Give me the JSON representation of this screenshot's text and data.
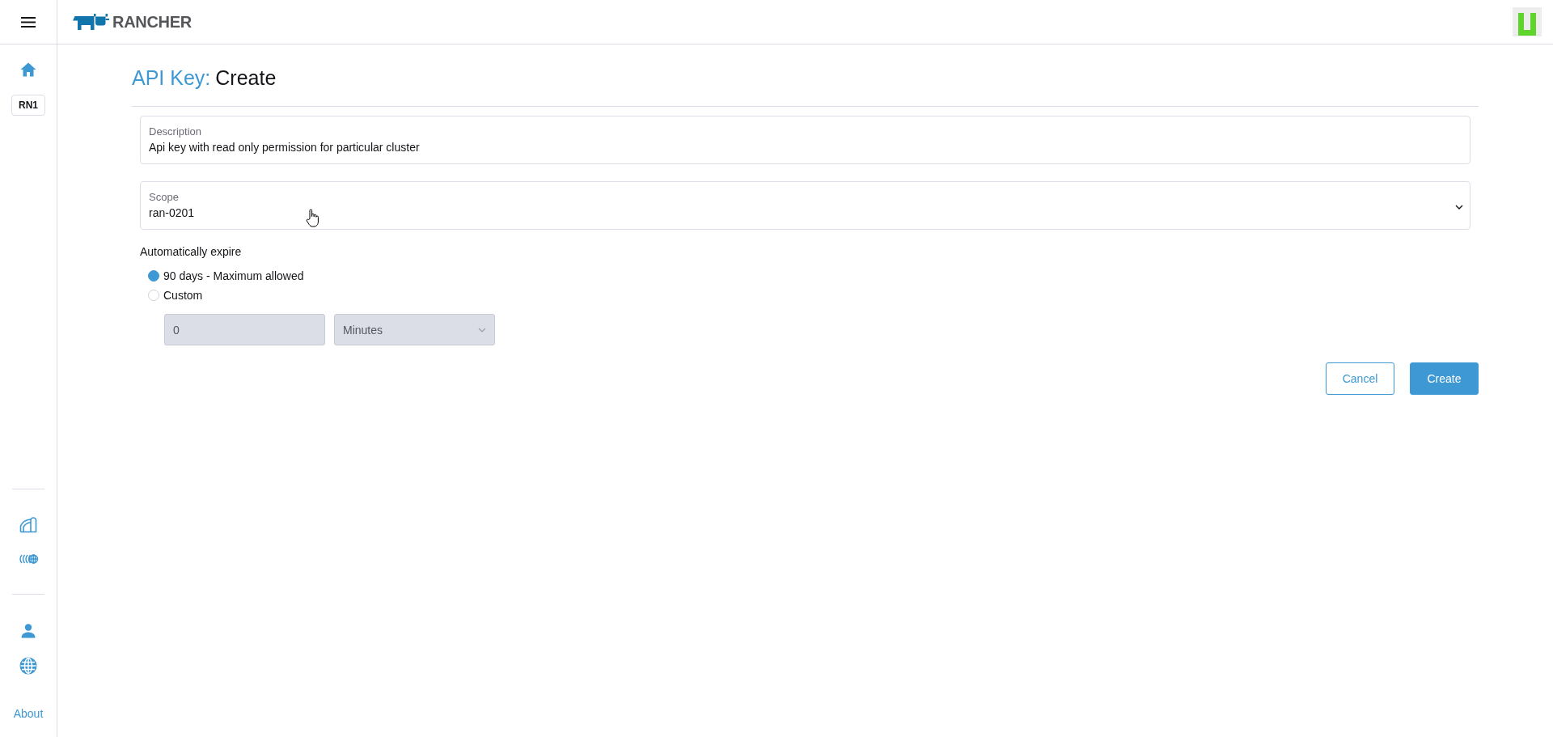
{
  "header": {
    "brand": "RANCHER"
  },
  "sidebar": {
    "cluster_badge": "RN1",
    "about_link": "About"
  },
  "page": {
    "title_prefix": "API Key:",
    "title": "Create"
  },
  "form": {
    "description": {
      "label": "Description",
      "value": "Api key with read only permission for particular cluster"
    },
    "scope": {
      "label": "Scope",
      "value": "ran-0201"
    },
    "expiry": {
      "label": "Automatically expire",
      "options": [
        {
          "label": "90 days - Maximum allowed",
          "selected": true
        },
        {
          "label": "Custom",
          "selected": false
        }
      ],
      "amount": {
        "value": "0",
        "disabled": true
      },
      "unit": {
        "value": "Minutes",
        "disabled": true
      }
    }
  },
  "buttons": [
    {
      "label": "Cancel",
      "kind": "secondary"
    },
    {
      "label": "Create",
      "kind": "primary"
    }
  ]
}
